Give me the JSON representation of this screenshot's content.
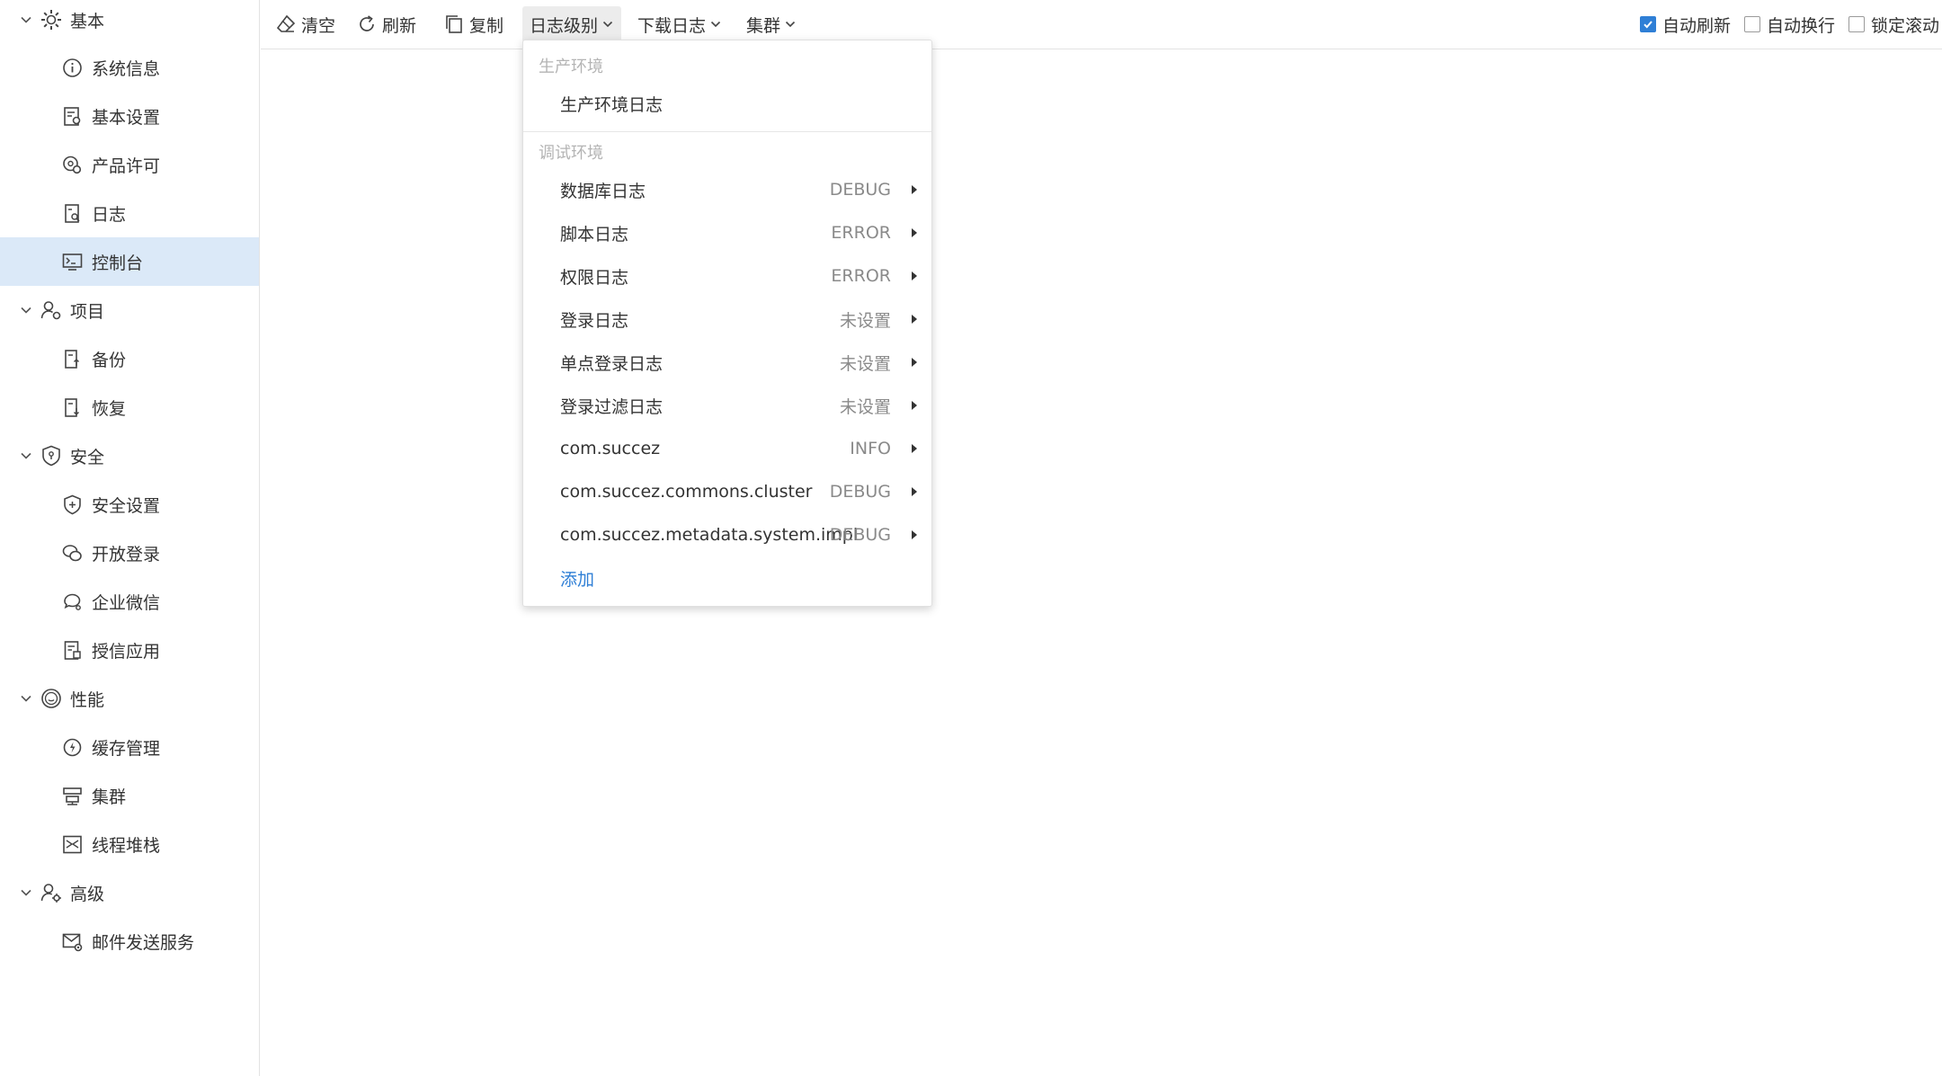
{
  "sidebar": {
    "groups": [
      {
        "label": "基本",
        "items": [
          {
            "label": "系统信息"
          },
          {
            "label": "基本设置"
          },
          {
            "label": "产品许可"
          },
          {
            "label": "日志"
          },
          {
            "label": "控制台",
            "active": true
          }
        ]
      },
      {
        "label": "项目",
        "items": [
          {
            "label": "备份"
          },
          {
            "label": "恢复"
          }
        ]
      },
      {
        "label": "安全",
        "items": [
          {
            "label": "安全设置"
          },
          {
            "label": "开放登录"
          },
          {
            "label": "企业微信"
          },
          {
            "label": "授信应用"
          }
        ]
      },
      {
        "label": "性能",
        "items": [
          {
            "label": "缓存管理"
          },
          {
            "label": "集群"
          },
          {
            "label": "线程堆栈"
          }
        ]
      },
      {
        "label": "高级",
        "items": [
          {
            "label": "邮件发送服务"
          }
        ]
      }
    ]
  },
  "toolbar": {
    "clear": "清空",
    "refresh": "刷新",
    "copy": "复制",
    "log_level": "日志级别",
    "download": "下载日志",
    "cluster": "集群",
    "auto_refresh": {
      "label": "自动刷新",
      "checked": true
    },
    "auto_wrap": {
      "label": "自动换行",
      "checked": false
    },
    "lock_scroll": {
      "label": "锁定滚动",
      "checked": false
    }
  },
  "log_level_menu": {
    "prod_section": "生产环境",
    "prod_item": "生产环境日志",
    "debug_section": "调试环境",
    "items": [
      {
        "label": "数据库日志",
        "value": "DEBUG"
      },
      {
        "label": "脚本日志",
        "value": "ERROR"
      },
      {
        "label": "权限日志",
        "value": "ERROR"
      },
      {
        "label": "登录日志",
        "value": "未设置"
      },
      {
        "label": "单点登录日志",
        "value": "未设置"
      },
      {
        "label": "登录过滤日志",
        "value": "未设置"
      },
      {
        "label": "com.succez",
        "value": "INFO"
      },
      {
        "label": "com.succez.commons.cluster",
        "value": "DEBUG"
      },
      {
        "label": "com.succez.metadata.system.impl",
        "value": "DEBUG"
      }
    ],
    "add": "添加"
  },
  "colors": {
    "accent": "#2f7fd6",
    "active_bg": "#dbe9f8",
    "muted_text": "#b4b4b4"
  }
}
